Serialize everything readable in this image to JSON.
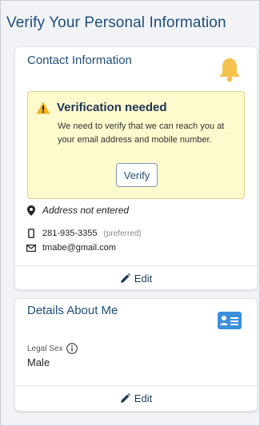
{
  "page": {
    "title": "Verify Your Personal Information"
  },
  "contact": {
    "title": "Contact Information",
    "alert": {
      "title": "Verification needed",
      "message": "We need to verify that we can reach you at your email address and mobile number.",
      "verify_label": "Verify"
    },
    "address": "Address not entered",
    "phone": "281-935-3355",
    "phone_note": "(preferred)",
    "email": "tmabe@gmail.com",
    "edit_label": "Edit"
  },
  "details": {
    "title": "Details About Me",
    "legal_sex_label": "Legal Sex",
    "legal_sex_value": "Male",
    "edit_label": "Edit"
  },
  "colors": {
    "accent": "#1f4e79",
    "bell": "#f5c24d",
    "alert_bg": "#fdfacd",
    "id_card": "#3b8fdc"
  }
}
